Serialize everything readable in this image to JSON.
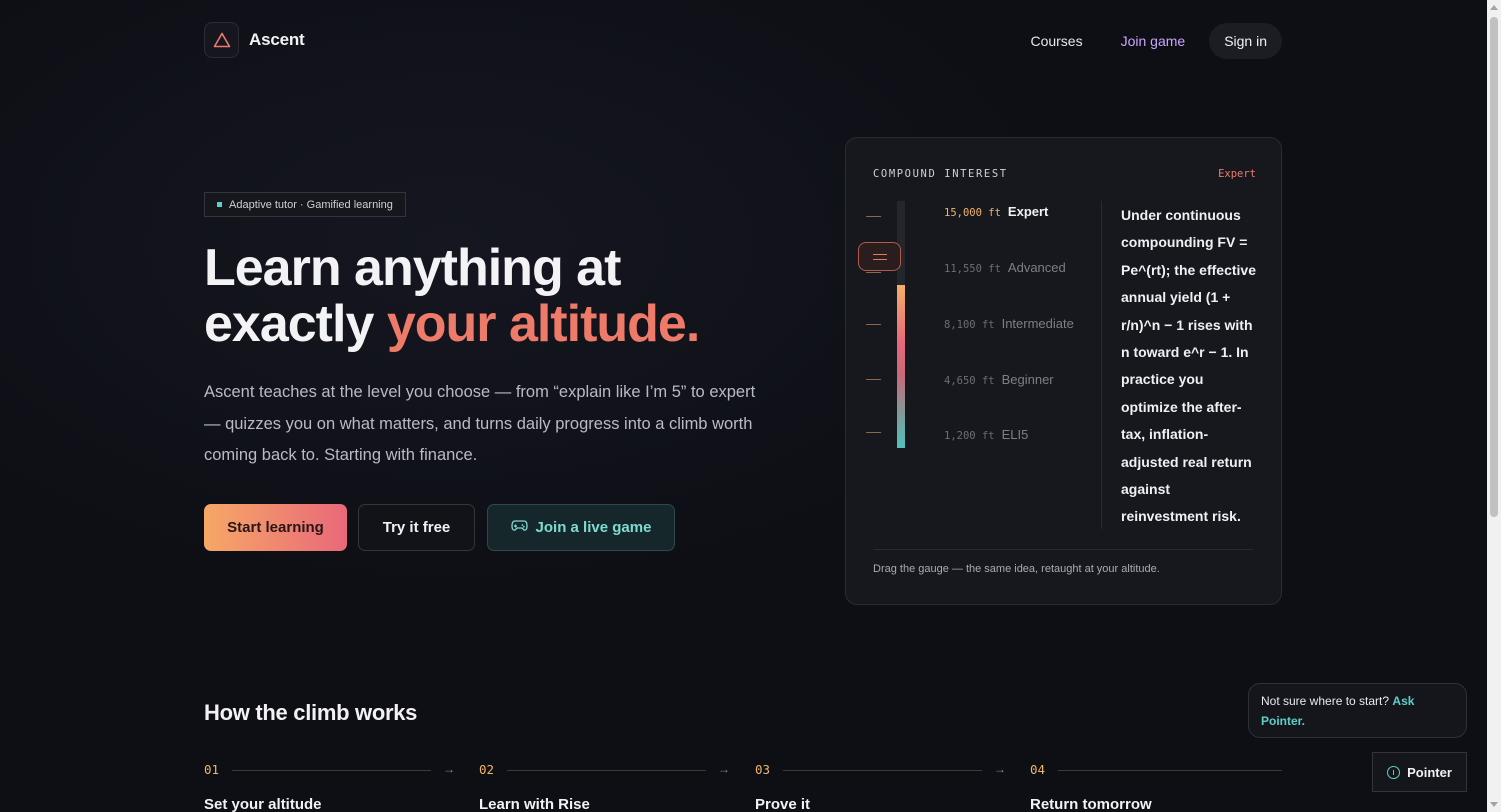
{
  "brand": {
    "name": "Ascent",
    "logo_icon": "triangle-icon",
    "accent": "#ee7a6a"
  },
  "nav": {
    "courses": "Courses",
    "join_game": "Join game",
    "sign_in": "Sign in"
  },
  "hero": {
    "badge": "Adaptive tutor · Gamified learning",
    "headline_line1": "Learn anything at",
    "headline_line2_plain": "exactly ",
    "headline_line2_highlight": "your altitude.",
    "subtext": "Ascent teaches at the level you choose — from “explain like I’m 5” to expert — quizzes you on what matters, and turns daily progress into a climb worth coming back to. Starting with finance.",
    "buttons": {
      "start": "Start learning",
      "try": "Try it free",
      "join": "Join a live game",
      "join_icon": "gamepad-icon"
    }
  },
  "gauge_card": {
    "title": "COMPOUND INTEREST",
    "current_level": "Expert",
    "levels": [
      {
        "altitude": "15,000",
        "unit": "ft",
        "name": "Expert"
      },
      {
        "altitude": "11,550",
        "unit": "ft",
        "name": "Advanced"
      },
      {
        "altitude": "8,100",
        "unit": "ft",
        "name": "Intermediate"
      },
      {
        "altitude": "4,650",
        "unit": "ft",
        "name": "Beginner"
      },
      {
        "altitude": "1,200",
        "unit": "ft",
        "name": "ELI5"
      }
    ],
    "explanation": "Under continuous compounding FV = Pe^(rt); the effective annual yield (1 + r/n)^n − 1 rises with n toward e^r − 1. In practice you optimize the after-tax, inflation-adjusted real return against reinvestment risk.",
    "footer": "Drag the gauge — the same idea, retaught at your altitude."
  },
  "how": {
    "title": "How the climb works",
    "steps": [
      {
        "num": "01",
        "label": "Set your altitude"
      },
      {
        "num": "02",
        "label": "Learn with Rise"
      },
      {
        "num": "03",
        "label": "Prove it"
      },
      {
        "num": "04",
        "label": "Return tomorrow"
      }
    ]
  },
  "pointer": {
    "prompt": "Not sure where to start?",
    "ask": "Ask Pointer.",
    "button": "Pointer"
  }
}
